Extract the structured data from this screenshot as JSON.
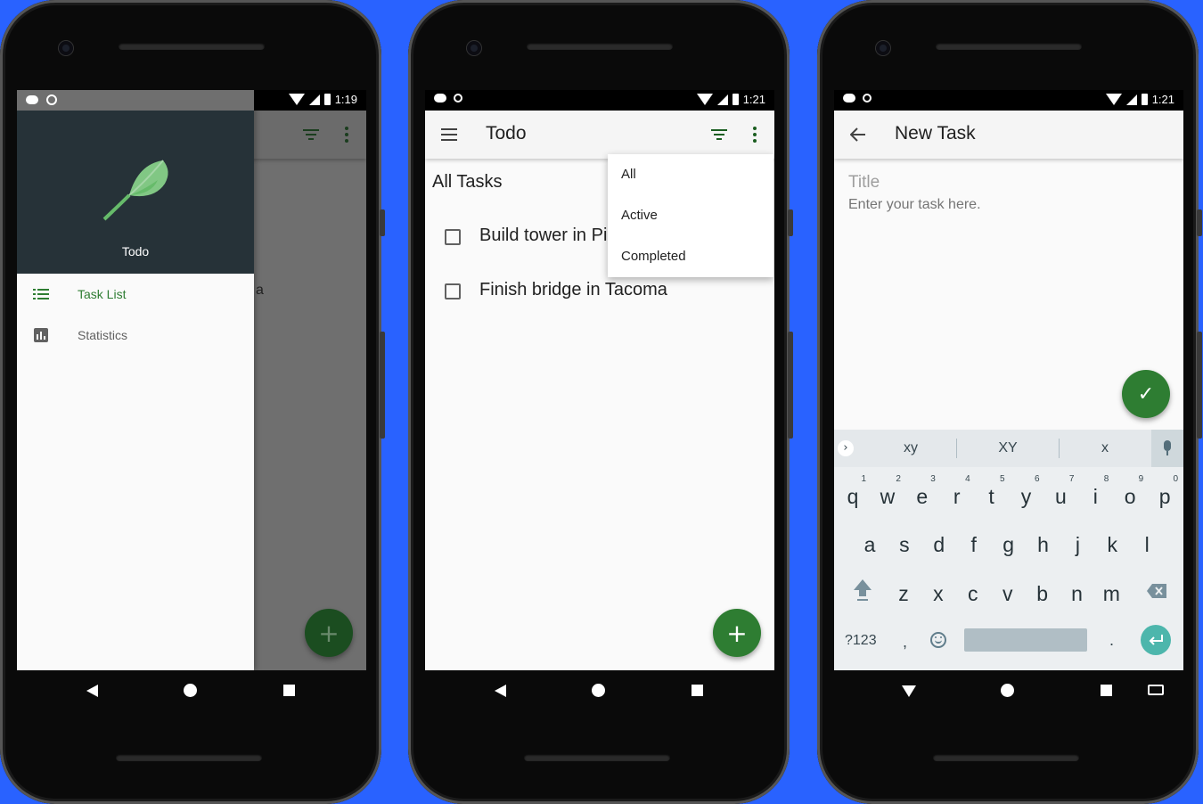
{
  "phones": [
    {
      "status_time": "1:19",
      "drawer": {
        "title": "Todo",
        "items": [
          {
            "label": "Task List",
            "icon": "list-icon",
            "color": "#2e7d32"
          },
          {
            "label": "Statistics",
            "icon": "bar-chart-icon",
            "color": "#616161"
          }
        ]
      },
      "background_peek_letter": "a",
      "fab_icon": "+"
    },
    {
      "status_time": "1:21",
      "toolbar_title": "Todo",
      "section_title": "All Tasks",
      "tasks": [
        {
          "title": "Build tower in Pi",
          "checked": false
        },
        {
          "title": "Finish bridge in Tacoma",
          "checked": false
        }
      ],
      "filter_menu": [
        "All",
        "Active",
        "Completed"
      ],
      "fab_icon": "+"
    },
    {
      "status_time": "1:21",
      "toolbar_title": "New Task",
      "title_label": "Title",
      "title_placeholder": "Enter your task here.",
      "fab_icon": "✓",
      "keyboard": {
        "suggestions": [
          "xy",
          "XY",
          "x"
        ],
        "row1": [
          {
            "ch": "q",
            "hint": "1"
          },
          {
            "ch": "w",
            "hint": "2"
          },
          {
            "ch": "e",
            "hint": "3"
          },
          {
            "ch": "r",
            "hint": "4"
          },
          {
            "ch": "t",
            "hint": "5"
          },
          {
            "ch": "y",
            "hint": "6"
          },
          {
            "ch": "u",
            "hint": "7"
          },
          {
            "ch": "i",
            "hint": "8"
          },
          {
            "ch": "o",
            "hint": "9"
          },
          {
            "ch": "p",
            "hint": "0"
          }
        ],
        "row2": [
          "a",
          "s",
          "d",
          "f",
          "g",
          "h",
          "j",
          "k",
          "l"
        ],
        "row3": [
          "z",
          "x",
          "c",
          "v",
          "b",
          "n",
          "m"
        ],
        "symbols_label": "?123",
        "comma": ",",
        "period": "."
      }
    }
  ],
  "colors": {
    "background": "#2962ff",
    "primary": "#2e7d32",
    "drawer_header": "#263238",
    "enter_key": "#4db6ac"
  }
}
